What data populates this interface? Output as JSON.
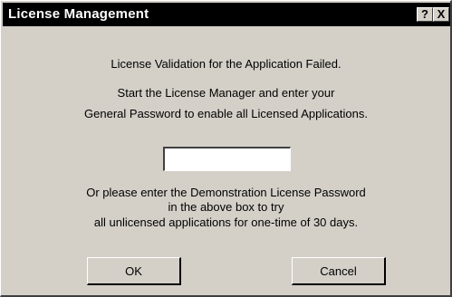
{
  "window": {
    "title": "License Management",
    "help_label": "?",
    "close_label": "X"
  },
  "messages": {
    "failed": "License Validation for the Application Failed.",
    "start_line1": "Start the License Manager and enter your",
    "start_line2": "General Password to enable all Licensed Applications.",
    "demo_line1": "Or please enter the Demonstration License Password",
    "demo_line2": "in the above box to try",
    "demo_line3": "all unlicensed applications for one-time of 30 days."
  },
  "password_field": {
    "value": "",
    "placeholder": ""
  },
  "buttons": {
    "ok_label": "OK",
    "cancel_label": "Cancel"
  },
  "colors": {
    "titlebar": "#000000",
    "face": "#d4d0c8"
  }
}
